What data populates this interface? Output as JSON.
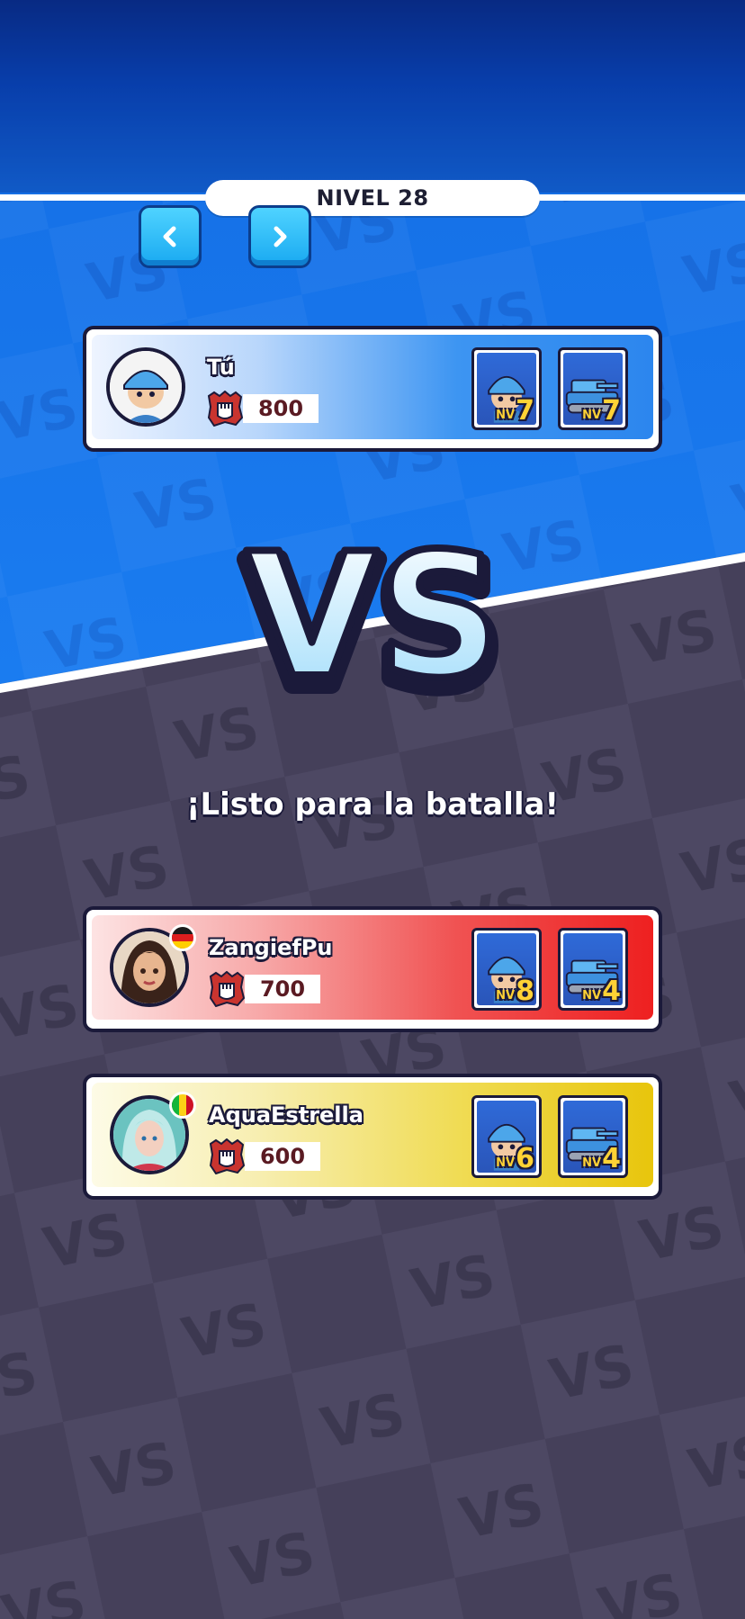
{
  "header": {
    "level_label": "NIVEL 28",
    "prev_icon": "chevron-left-icon",
    "next_icon": "chevron-right-icon"
  },
  "vs_text": "VS",
  "ready_text": "¡Listo para la batalla!",
  "players": [
    {
      "name": "Tú",
      "score": "800",
      "card_color": "#2e8df0",
      "avatar": "soldier-avatar",
      "flag": null,
      "units": [
        {
          "icon": "soldier-unit-icon",
          "nv": "NV",
          "level": "7"
        },
        {
          "icon": "tank-unit-icon",
          "nv": "NV",
          "level": "7"
        }
      ]
    },
    {
      "name": "ZangiefPu",
      "score": "700",
      "card_color": "#ee2b2b",
      "avatar": "woman-avatar",
      "flag": "germany-flag-icon",
      "units": [
        {
          "icon": "soldier-unit-icon",
          "nv": "NV",
          "level": "8"
        },
        {
          "icon": "tank-unit-icon",
          "nv": "NV",
          "level": "4"
        }
      ]
    },
    {
      "name": "AquaEstrella",
      "score": "600",
      "card_color": "#eccb10",
      "avatar": "warrior-avatar",
      "flag": "mali-flag-icon",
      "units": [
        {
          "icon": "soldier-unit-icon",
          "nv": "NV",
          "level": "6"
        },
        {
          "icon": "tank-unit-icon",
          "nv": "NV",
          "level": "4"
        }
      ]
    }
  ],
  "colors": {
    "top_blue": "#1872e8",
    "bottom_gray": "#45405a",
    "outline": "#1b1a3a"
  }
}
